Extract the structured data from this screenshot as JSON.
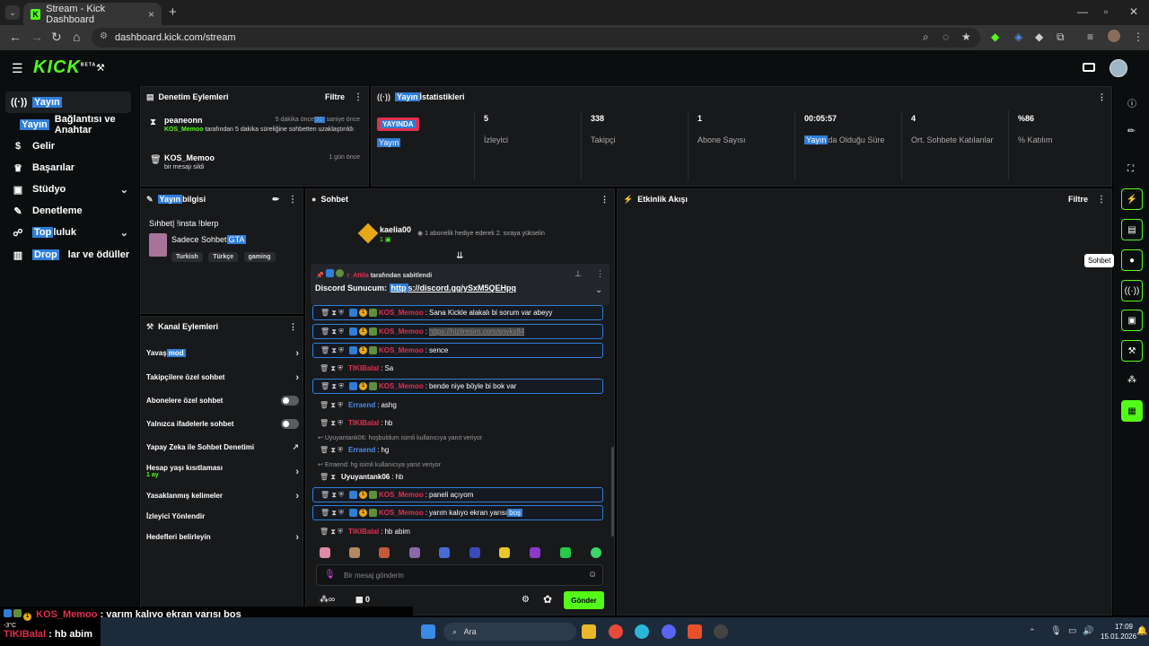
{
  "browser": {
    "tab_title": "Stream - Kick Dashboard",
    "tab_favicon": "K",
    "new_tab": "+",
    "url": "dashboard.kick.com/stream"
  },
  "header": {
    "logo": "KICK",
    "logo_beta": "BETA"
  },
  "sidebar": {
    "items": [
      {
        "label": "Yayın",
        "icon": "broadcast-icon"
      },
      {
        "label_hl": "Yayın",
        "label": "Bağlantısı ve Anahtar"
      },
      {
        "label": "Gelir",
        "icon": "dollar-icon"
      },
      {
        "label": "Başarılar",
        "icon": "trophy-icon"
      },
      {
        "label": "Stüdyo",
        "icon": "studio-icon"
      },
      {
        "label": "Denetleme",
        "icon": "wrench-icon"
      },
      {
        "label_hl": "Top",
        "label": "luluk",
        "icon": "community-icon"
      },
      {
        "label_hl": "Drop",
        "label": "lar ve ödüller",
        "icon": "drops-icon"
      }
    ]
  },
  "moderation": {
    "title": "Denetim Eylemleri",
    "filter": "Filtre",
    "entries": [
      {
        "user": "peaneonn",
        "time": "5 dakika önce",
        "time_hl": "31",
        "time_suffix": " saniye önce",
        "actor": "KOS_Memoo",
        "desc": " tarafından 5 dakika süreliğine sohbetten uzaklaştırıldı"
      },
      {
        "user": "KOS_Memoo",
        "time": "1 gün önce",
        "desc": "bir mesajı sildi"
      }
    ]
  },
  "stats": {
    "title_hl": "Yayın",
    "title": " İstatistikleri",
    "live_badge": "YAYINDA",
    "live_label": "Yayın",
    "items": [
      {
        "value": "5",
        "label": "İzleyici"
      },
      {
        "value": "338",
        "label": "Takipçi"
      },
      {
        "value": "1",
        "label": "Abone Sayısı"
      },
      {
        "value": "00:05:57",
        "label_hl": "Yayın",
        "label": "da Olduğu Süre"
      },
      {
        "value": "4",
        "label": "Ort. Sohbete Katılanlar"
      },
      {
        "value": "%86",
        "label": "% Katılım"
      }
    ]
  },
  "stream_info": {
    "title_hl": "Yayın",
    "title": " bilgisi",
    "stream_title": "Sıhbet| !insta !blerp",
    "category": "Sadece Sohbet",
    "category_hl": "GTA",
    "tags": [
      "Turkish",
      "Türkçe",
      "gaming"
    ]
  },
  "channel_actions": {
    "title_hl": "anal",
    "title": "Kanal Eylemleri",
    "items": [
      {
        "label": "Yavaş ",
        "label_hl": "mod",
        "control": "arrow"
      },
      {
        "label": "Takipçilere özel sohbet",
        "control": "arrow"
      },
      {
        "label": "Abonelere özel sohbet",
        "control": "toggle"
      },
      {
        "label": "Yalnızca ifadelerle sohbet",
        "control": "toggle"
      },
      {
        "label": "Yapay Zeka ile Sohbet Denetimi",
        "control": "external"
      },
      {
        "label": "Hesap yaşı kısıtlaması",
        "sub": "1 ay",
        "control": "arrow"
      },
      {
        "label": "Yasaklanmış kelimeler",
        "control": "arrow"
      },
      {
        "label": "İzleyici Yönlendir",
        "control": "none"
      },
      {
        "label": "Hedefleri belirleyin",
        "control": "arrow"
      }
    ]
  },
  "chat": {
    "title": "Sohbet",
    "gift_user": "kaelia00",
    "gift_text": "1 abonelik hediye ederek 2. sıraya yükselin",
    "pinned_by": "tarafından sabitlendi",
    "pinned_user": "r_Attila",
    "pinned_msg": "Discord Sunucum: ",
    "pinned_link_hl": "http",
    "pinned_link": "s://discord.gg/ySxM5QEHpq",
    "messages": [
      {
        "user": "KOS_Memoo",
        "text": "Sana Kickle alakalı bi sorum var abeyy",
        "style": "red",
        "box": true
      },
      {
        "user": "KOS_Memoo",
        "text": "https://hizliresim.com/snvks84",
        "style": "red",
        "box": true
      },
      {
        "user": "KOS_Memoo",
        "text": "sence",
        "style": "red",
        "box": true
      },
      {
        "user": "TIKIBalal",
        "text": "Sa",
        "style": "red",
        "box": false
      },
      {
        "user": "KOS_Memoo",
        "text": "bende niye böyle bi bok var",
        "style": "red",
        "box": true
      },
      {
        "user": "Erraend",
        "text": "ashg",
        "style": "blue",
        "box": false
      },
      {
        "user": "TIKIBalal",
        "text": "hb",
        "style": "red",
        "box": false
      },
      {
        "user": "Erraend",
        "text": "hg",
        "style": "blue",
        "box": false,
        "reply": "Uyuyantank06: hoşbuldum isimli kullanıcıya yanıt veriyor"
      },
      {
        "user": "Uyuyantank06",
        "text": "hb",
        "style": "white",
        "box": false,
        "reply": "Erraend: hg isimli kullanıcıya yanıt veriyor"
      },
      {
        "user": "KOS_Memoo",
        "text": "paneli açıyom",
        "style": "red",
        "box": true
      },
      {
        "user": "KOS_Memoo",
        "text": "yarım kalıyo ekran yarısı ",
        "text_hl": "boş",
        "style": "red",
        "box": true
      },
      {
        "user": "TIKIBalal",
        "text": "hb abim",
        "style": "red",
        "box": false
      }
    ],
    "input_placeholder": "Bir mesaj gönderin",
    "points": "0",
    "send": "Gönder"
  },
  "activity": {
    "title": "Etkinlik Akışı",
    "filter": "Filtre"
  },
  "right_rail": {
    "tooltip": "Sohbet"
  },
  "overlay": {
    "line1_user": "KOS_Memoo",
    "line1_text": " : yarım kalıyo ekran yarısı boş",
    "line2_user": "TIKIBalal",
    "line2_text": " : hb abim",
    "temp": "-3°C"
  },
  "taskbar": {
    "search": "Ara",
    "time": "17:09",
    "date": "15.01.2026"
  },
  "colors": {
    "accent": "#53fc18",
    "highlight": "#2f7ed8",
    "live": "#e0314f"
  }
}
